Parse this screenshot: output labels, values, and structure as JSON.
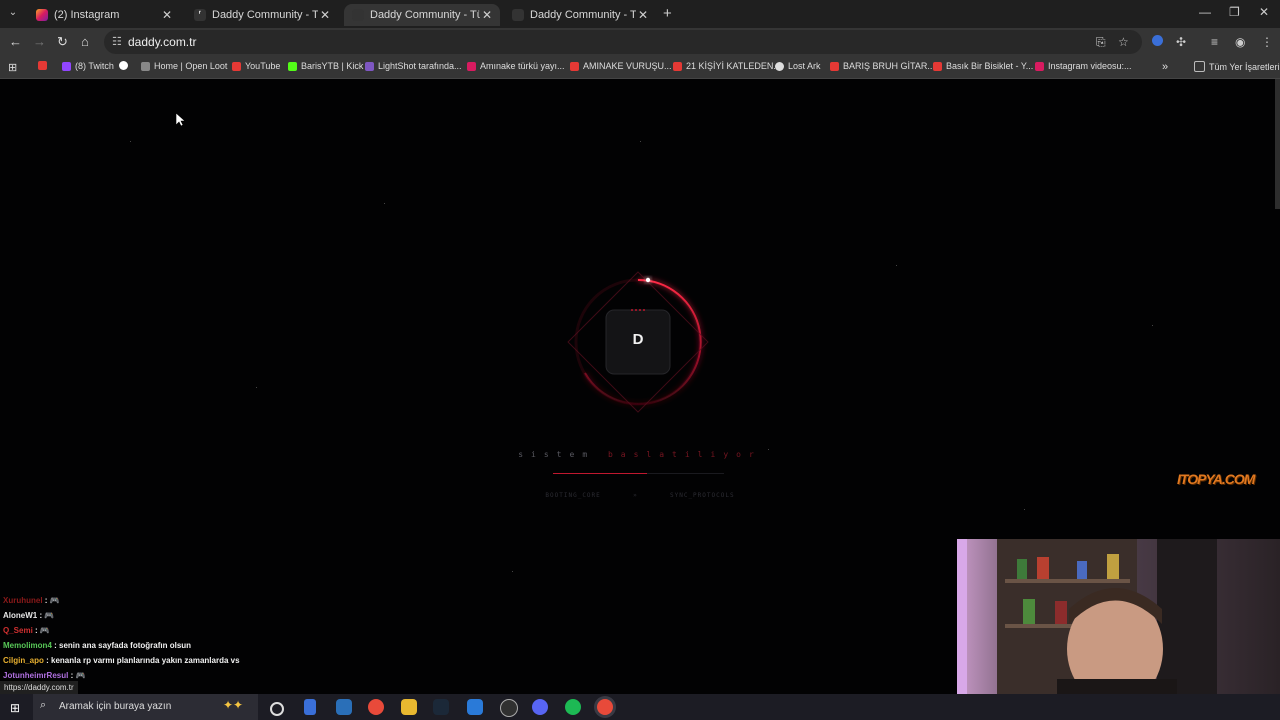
{
  "browser": {
    "tabs": [
      {
        "title": "(2) Instagram",
        "favicon": "instagram-icon",
        "active": false
      },
      {
        "title": "Daddy Community - Türkiye'nin",
        "favicon": "daddy-icon",
        "active": false
      },
      {
        "title": "Daddy Community - Türkiye'nin",
        "favicon": "daddy-icon",
        "active": true
      },
      {
        "title": "Daddy Community - Türkiye'nin",
        "favicon": "daddy-icon",
        "active": false
      }
    ],
    "url": "daddy.com.tr",
    "bookmarks": [
      {
        "label": "",
        "icon": "youtube-icon"
      },
      {
        "label": "(8) Twitch",
        "icon": "twitch-icon"
      },
      {
        "label": "",
        "icon": "google-icon"
      },
      {
        "label": "Home | Open Loot",
        "icon": "openloot-icon"
      },
      {
        "label": "YouTube",
        "icon": "youtube-icon"
      },
      {
        "label": "BarisYTB | Kick",
        "icon": "kick-icon"
      },
      {
        "label": "LightShot tarafında...",
        "icon": "lightshot-icon"
      },
      {
        "label": "Amınake türkü yayı...",
        "icon": "instagram-icon"
      },
      {
        "label": "AMINAKE VURUŞU...",
        "icon": "youtube-icon"
      },
      {
        "label": "21 KİŞİYİ KATLEDEN...",
        "icon": "youtube-icon"
      },
      {
        "label": "Lost Ark",
        "icon": "globe-icon"
      },
      {
        "label": "BARIŞ BRUH GİTAR...",
        "icon": "youtube-icon"
      },
      {
        "label": "Basık Bir Bisiklet - Y...",
        "icon": "youtube-icon"
      },
      {
        "label": "Instagram videosu:...",
        "icon": "instagram-icon"
      }
    ],
    "all_bookmarks": "Tüm Yer İşaretleri",
    "status_url": "https://daddy.com.tr"
  },
  "page": {
    "logo_letter": "D",
    "system_text": "sistem",
    "system_text_accent": "baslatiliyor",
    "boot_left": "BOOTING_CORE",
    "boot_sep": "»",
    "boot_right": "SYNC_PROTOCOLS",
    "progress": 0.55
  },
  "overlay": {
    "watermark": "ITOPYA.COM",
    "chat": [
      {
        "user": "Xuruhunel",
        "text": "🎮",
        "color": "#8b1a1a"
      },
      {
        "user": "AloneW1",
        "text": "🎮",
        "color": "#e8e8e8"
      },
      {
        "user": "Q_Semi",
        "text": "🎮",
        "color": "#d03030"
      },
      {
        "user": "Memolimon4",
        "text": "senin ana sayfada fotoğrafın olsun",
        "color": "#58c858"
      },
      {
        "user": "Cilgin_apo",
        "text": "kenanla rp varmı planlarında yakın zamanlarda vs",
        "color": "#e8b030"
      },
      {
        "user": "JotunheimrResul",
        "text": "🎮",
        "color": "#b070e0"
      }
    ]
  },
  "taskbar": {
    "search_placeholder": "Aramak için buraya yazın",
    "apps": [
      "task-view-icon",
      "app-icon",
      "calculator-icon",
      "chrome-icon",
      "file-explorer-icon",
      "steam-icon",
      "app-icon",
      "obs-icon",
      "discord-icon",
      "spotify-icon",
      "chrome-icon"
    ]
  },
  "colors": {
    "accent": "#c0182f",
    "tab_bar": "#1f1f1f",
    "toolbar": "#353535"
  }
}
